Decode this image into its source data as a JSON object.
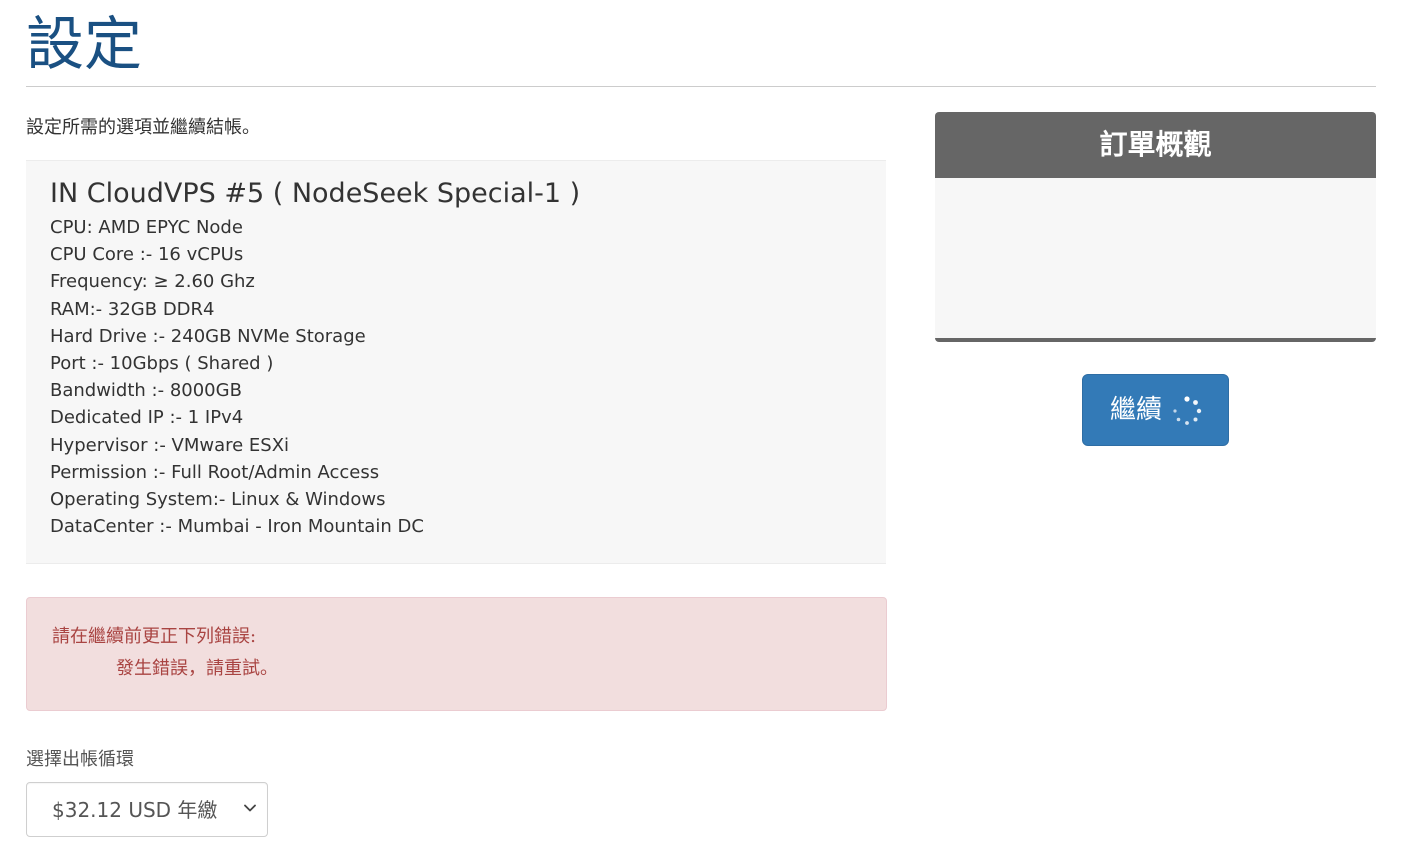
{
  "page": {
    "title": "設定",
    "intro": "設定所需的選項並繼續結帳。"
  },
  "product": {
    "name": "IN CloudVPS #5 ( NodeSeek Special-1 )",
    "specs": [
      "CPU: AMD EPYC Node",
      "CPU Core :- 16 vCPUs",
      "Frequency: ≥ 2.60 Ghz",
      "RAM:- 32GB DDR4",
      "Hard Drive :- 240GB NVMe Storage",
      "Port :- 10Gbps ( Shared )",
      "Bandwidth :- 8000GB",
      "Dedicated IP :- 1 IPv4",
      "Hypervisor :- VMware ESXi",
      "Permission :- Full Root/Admin Access",
      "Operating System:- Linux & Windows",
      "DataCenter :- Mumbai - Iron Mountain DC"
    ]
  },
  "error": {
    "heading": "請在繼續前更正下列錯誤:",
    "items": [
      "發生錯誤，請重試。"
    ]
  },
  "billing": {
    "label": "選擇出帳循環",
    "selected": "$32.12 USD 年繳"
  },
  "summary": {
    "title": "訂單概觀"
  },
  "continue_button": {
    "label": "繼續",
    "state": "loading"
  },
  "colors": {
    "title": "#1a5082",
    "primary": "#337ab7",
    "error_bg": "#f2dede",
    "error_text": "#a94442",
    "summary_header": "#666666"
  },
  "icons": {
    "select_arrow": "chevron-down-icon",
    "loading": "spinner-icon"
  }
}
